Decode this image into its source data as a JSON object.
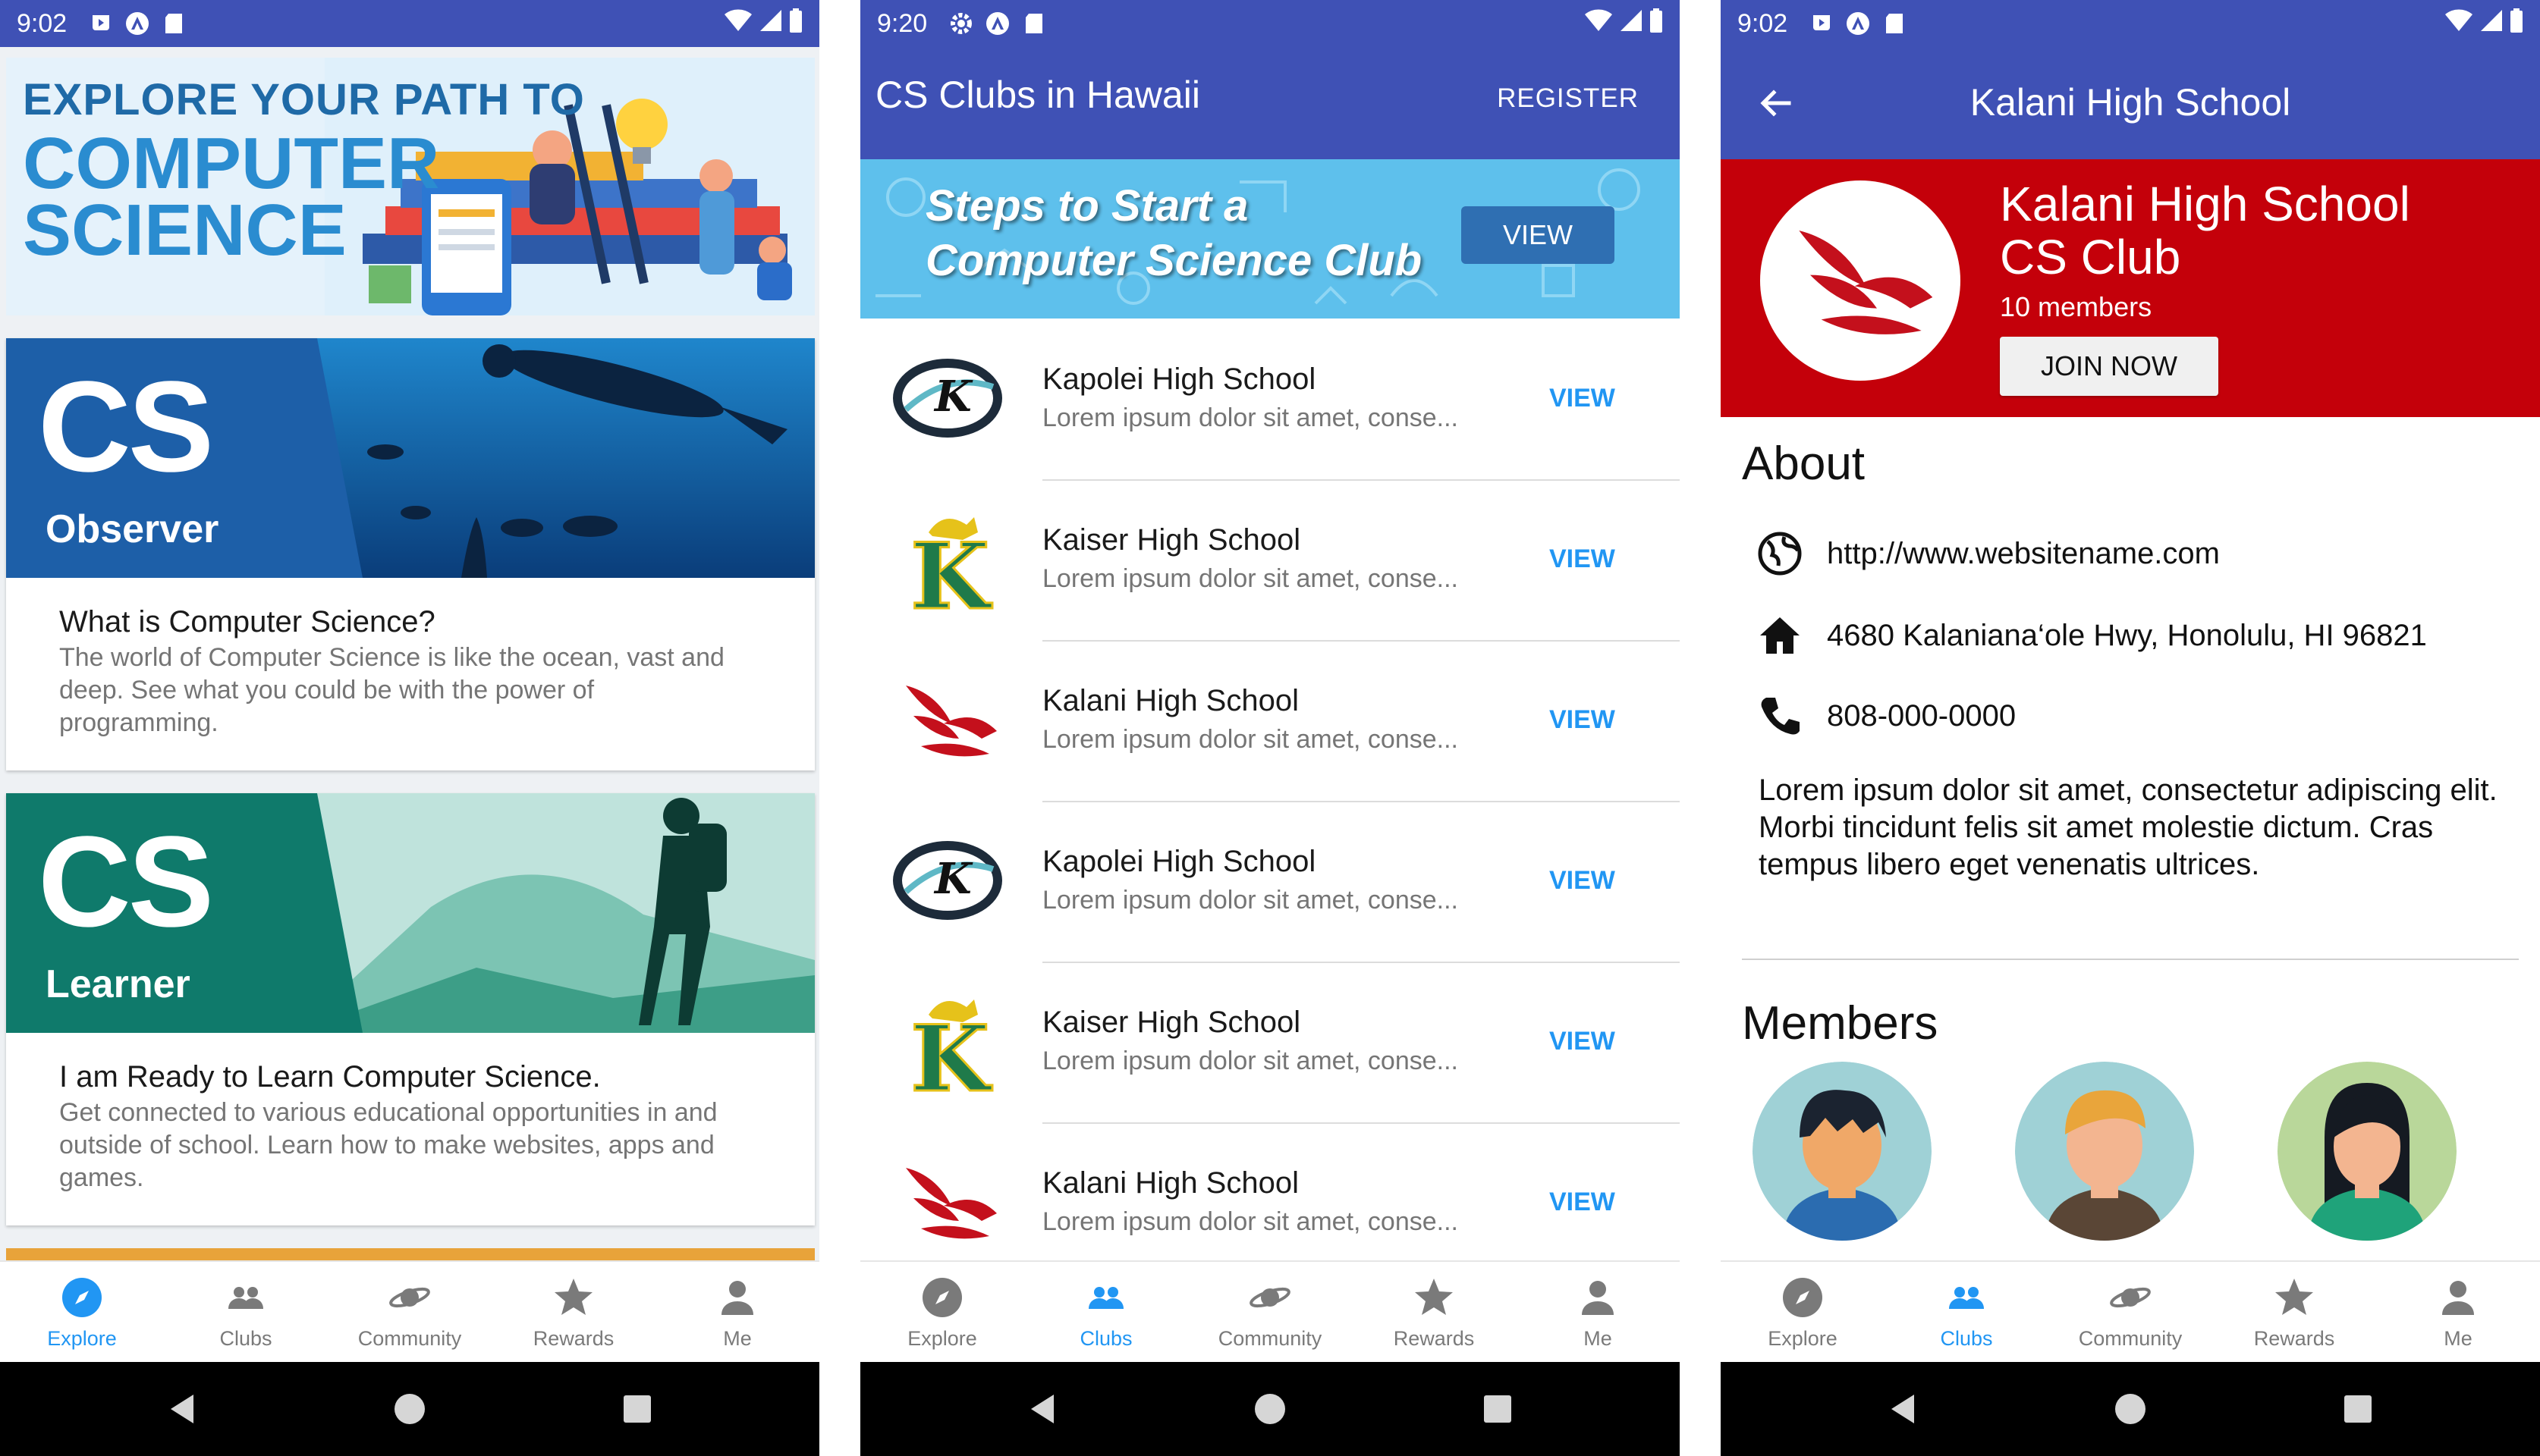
{
  "screens": {
    "explore": {
      "status_time": "9:02",
      "banner": {
        "line1": "EXPLORE YOUR PATH TO",
        "line2": "COMPUTER",
        "line3": "SCIENCE"
      },
      "cards": [
        {
          "big": "CS",
          "sub": "Observer",
          "title": "What is Computer Science?",
          "desc": "The world of Computer Science is like the ocean, vast and deep. See what you could be with the power of programming."
        },
        {
          "big": "CS",
          "sub": "Learner",
          "title": "I am Ready to Learn Computer Science.",
          "desc": "Get connected to various educational opportunities in and outside of school. Learn how to make websites, apps and games."
        }
      ]
    },
    "clubs": {
      "status_time": "9:20",
      "title": "CS Clubs in Hawaii",
      "register": "REGISTER",
      "banner": {
        "line1": "Steps to Start a",
        "line2": "Computer Science Club",
        "button": "VIEW"
      },
      "items": [
        {
          "name": "Kapolei High School",
          "desc": "Lorem ipsum dolor sit amet, conse...",
          "action": "VIEW",
          "logo": "kapolei-logo"
        },
        {
          "name": "Kaiser High School",
          "desc": "Lorem ipsum dolor sit amet, conse...",
          "action": "VIEW",
          "logo": "kaiser-logo"
        },
        {
          "name": "Kalani High School",
          "desc": "Lorem ipsum dolor sit amet, conse...",
          "action": "VIEW",
          "logo": "kalani-logo"
        },
        {
          "name": "Kapolei High School",
          "desc": "Lorem ipsum dolor sit amet, conse...",
          "action": "VIEW",
          "logo": "kapolei-logo"
        },
        {
          "name": "Kaiser High School",
          "desc": "Lorem ipsum dolor sit amet, conse...",
          "action": "VIEW",
          "logo": "kaiser-logo"
        },
        {
          "name": "Kalani High School",
          "desc": "Lorem ipsum dolor sit amet, conse...",
          "action": "VIEW",
          "logo": "kalani-logo"
        }
      ]
    },
    "club_detail": {
      "status_time": "9:02",
      "title": "Kalani High School",
      "club_name": "Kalani High School CS Club",
      "members_count": "10 members",
      "join": "JOIN NOW",
      "about_heading": "About",
      "website": "http://www.websitename.com",
      "address": "4680 Kalaniana‘ole Hwy, Honolulu, HI 96821",
      "phone": "808-000-0000",
      "about": "Lorem ipsum dolor sit amet, consectetur adipiscing elit. Morbi tincidunt felis sit amet molestie dictum. Cras tempus libero eget venenatis ultrices.",
      "members_heading": "Members"
    }
  },
  "nav": {
    "items": [
      "Explore",
      "Clubs",
      "Community",
      "Rewards",
      "Me"
    ]
  },
  "colors": {
    "primary": "#3f51b5",
    "accent": "#2196f3",
    "club_red": "#c4000a"
  }
}
